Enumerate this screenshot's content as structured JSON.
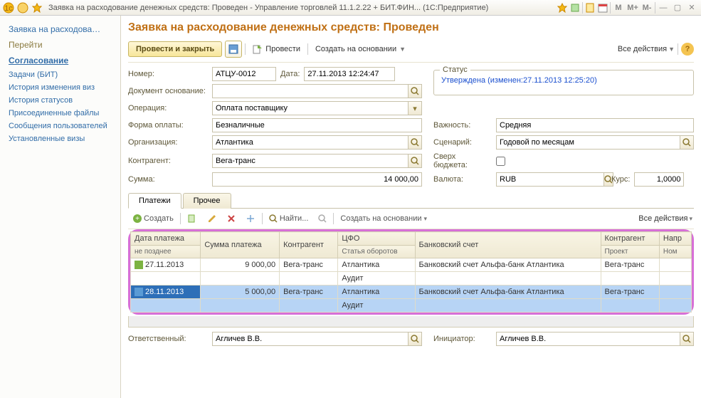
{
  "window": {
    "title": "Заявка на расходование денежных средств: Проведен - Управление торговлей 11.1.2.22 + БИТ.ФИН... (1С:Предприятие)",
    "m": "M",
    "mplus": "M+",
    "mminus": "M-"
  },
  "sidebar": {
    "title": "Заявка на расходова…",
    "sections": [
      "Перейти",
      "Согласование"
    ],
    "links": [
      "Задачи (БИТ)",
      "История изменения виз",
      "История статусов",
      "Присоединенные файлы",
      "Сообщения пользователей",
      "Установленные визы"
    ]
  },
  "page": {
    "title": "Заявка на расходование денежных средств: Проведен",
    "toolbar": {
      "post_close": "Провести и закрыть",
      "post": "Провести",
      "create_based": "Создать на основании",
      "all_actions": "Все действия"
    },
    "fields": {
      "number_lbl": "Номер:",
      "number": "АТЦУ-0012",
      "date_lbl": "Дата:",
      "date": "27.11.2013 12:24:47",
      "basis_lbl": "Документ основание:",
      "basis": "",
      "operation_lbl": "Операция:",
      "operation": "Оплата поставщику",
      "payform_lbl": "Форма оплаты:",
      "payform": "Безналичные",
      "org_lbl": "Организация:",
      "org": "Атлантика",
      "contractor_lbl": "Контрагент:",
      "contractor": "Вега-транс",
      "sum_lbl": "Сумма:",
      "sum": "14 000,00",
      "importance_lbl": "Важность:",
      "importance": "Средняя",
      "scenario_lbl": "Сценарий:",
      "scenario": "Годовой по месяцам",
      "overbudget_lbl": "Сверх бюджета:",
      "currency_lbl": "Валюта:",
      "currency": "RUB",
      "rate_lbl": "Курс:",
      "rate": "1,0000"
    },
    "status": {
      "legend": "Статус",
      "text": "Утверждена (изменен:27.11.2013 12:25:20)"
    },
    "tabs": {
      "payments": "Платежи",
      "other": "Прочее"
    },
    "grid_toolbar": {
      "create": "Создать",
      "find": "Найти...",
      "create_based": "Создать на основании",
      "all_actions": "Все действия"
    },
    "columns": {
      "date": "Дата платежа",
      "date_sub": "не позднее",
      "sum": "Сумма платежа",
      "contractor": "Контрагент",
      "cfo": "ЦФО",
      "cfo_sub": "Статья оборотов",
      "bank": "Банковский счет",
      "contractor2": "Контрагент",
      "contractor2_sub": "Проект",
      "dir": "Напр",
      "dir_sub": "Ном"
    },
    "rows": [
      {
        "date": "27.11.2013",
        "sum": "9 000,00",
        "contractor": "Вега-транс",
        "cfo": "Атлантика",
        "cfo2": "Аудит",
        "bank": "Банковский счет Альфа-банк Атлантика",
        "contractor2": "Вега-транс",
        "sel": false
      },
      {
        "date": "28.11.2013",
        "sum": "5 000,00",
        "contractor": "Вега-транс",
        "cfo": "Атлантика",
        "cfo2": "Аудит",
        "bank": "Банковский счет Альфа-банк Атлантика",
        "contractor2": "Вега-транс",
        "sel": true
      }
    ],
    "footer": {
      "responsible_lbl": "Ответственный:",
      "responsible": "Агличев В.В.",
      "initiator_lbl": "Инициатор:",
      "initiator": "Агличев В.В."
    }
  }
}
